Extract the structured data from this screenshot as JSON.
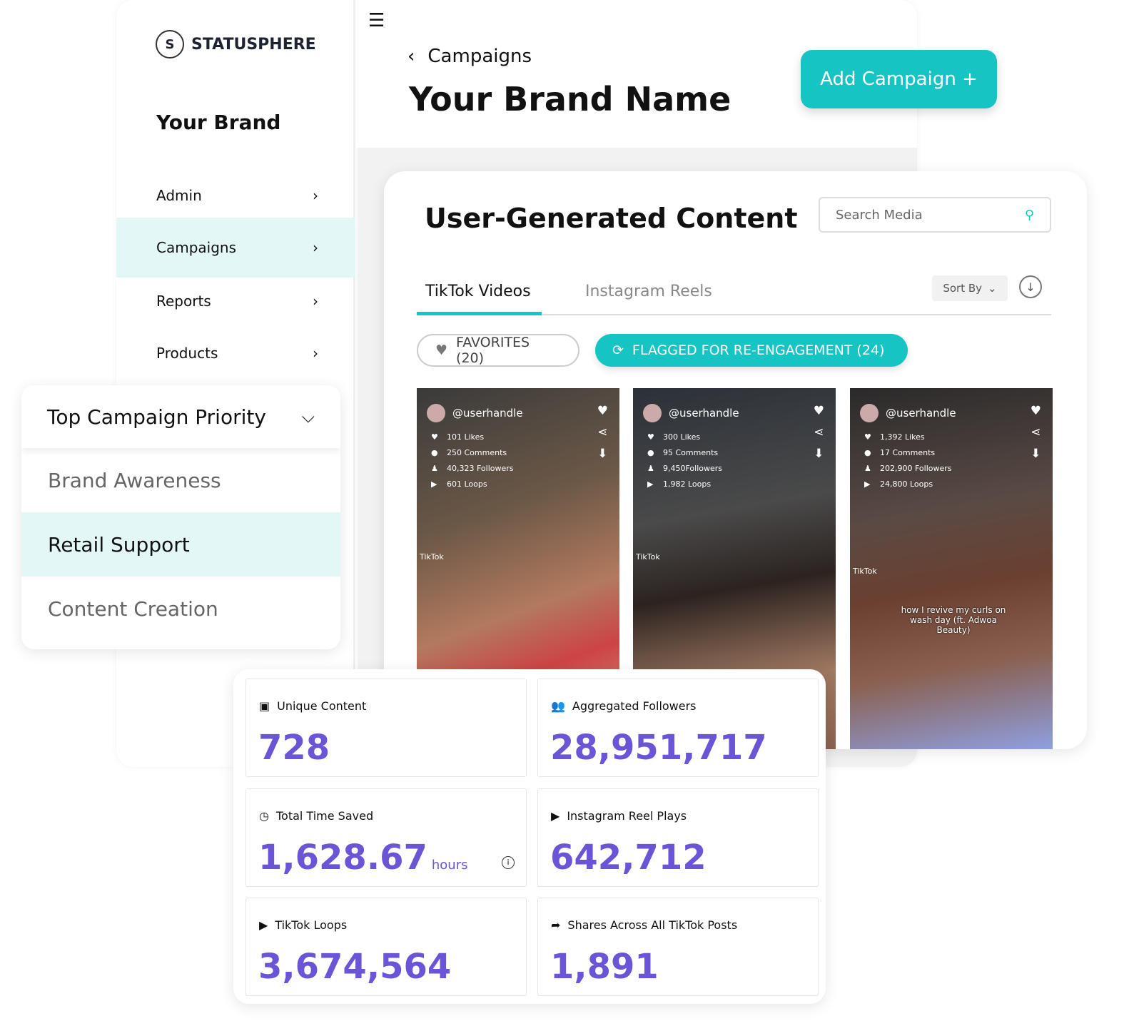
{
  "sidebar": {
    "logo": "STATUSPHERE",
    "brand": "Your Brand",
    "items": [
      {
        "label": "Admin"
      },
      {
        "label": "Campaigns",
        "active": true
      },
      {
        "label": "Reports"
      },
      {
        "label": "Products"
      }
    ]
  },
  "header": {
    "breadcrumb": "Campaigns",
    "title": "Your Brand Name",
    "add_button": "Add Campaign +"
  },
  "ugc": {
    "title": "User-Generated Content",
    "search_placeholder": "Search Media",
    "tabs": [
      "TikTok Videos",
      "Instagram Reels"
    ],
    "sort": "Sort By",
    "filters": {
      "favorites": "FAVORITES (20)",
      "flagged": "FLAGGED FOR RE-ENGAGEMENT (24)"
    },
    "videos": [
      {
        "handle": "@userhandle",
        "likes": "101 Likes",
        "comments": "250 Comments",
        "followers": "40,323 Followers",
        "loops": "601 Loops",
        "platform": "TikTok",
        "caption": ""
      },
      {
        "handle": "@userhandle",
        "likes": "300 Likes",
        "comments": "95 Comments",
        "followers": "9,450Followers",
        "loops": "1,982 Loops",
        "platform": "TikTok",
        "caption": ""
      },
      {
        "handle": "@userhandle",
        "likes": "1,392 Likes",
        "comments": "17 Comments",
        "followers": "202,900 Followers",
        "loops": "24,800 Loops",
        "platform": "TikTok",
        "caption": "how I revive my curls on wash day (ft. Adwoa Beauty)"
      }
    ]
  },
  "priority": {
    "label": "Top Campaign Priority",
    "options": [
      "Brand Awareness",
      "Retail Support",
      "Content Creation"
    ],
    "selected": "Retail Support"
  },
  "stats": [
    {
      "label": "Unique Content",
      "value": "728",
      "unit": ""
    },
    {
      "label": "Aggregated Followers",
      "value": "28,951,717",
      "unit": ""
    },
    {
      "label": "Total Time Saved",
      "value": "1,628.67",
      "unit": "hours"
    },
    {
      "label": "Instagram Reel Plays",
      "value": "642,712",
      "unit": ""
    },
    {
      "label": "TikTok Loops",
      "value": "3,674,564",
      "unit": ""
    },
    {
      "label": "Shares Across All TikTok Posts",
      "value": "1,891",
      "unit": ""
    }
  ],
  "colors": {
    "accent": "#17c4c4",
    "highlight": "#e3f7f6",
    "stat": "#6b55d6"
  }
}
